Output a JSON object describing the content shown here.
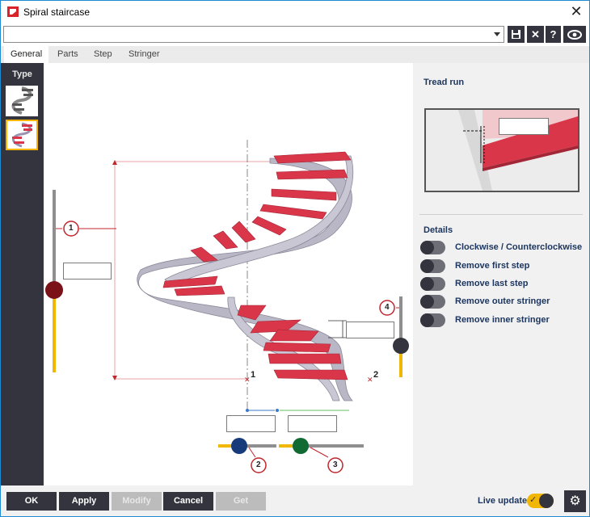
{
  "window": {
    "title": "Spiral staircase"
  },
  "toolbar": {
    "combo_value": "",
    "save_icon": "save-icon",
    "delete_icon": "close-icon",
    "help_label": "?",
    "view_icon": "eye-icon"
  },
  "tabs": [
    {
      "label": "General",
      "active": true
    },
    {
      "label": "Parts",
      "active": false
    },
    {
      "label": "Step",
      "active": false
    },
    {
      "label": "Stringer",
      "active": false
    }
  ],
  "type_panel": {
    "label": "Type"
  },
  "canvas": {
    "marker_1": "1",
    "marker_2": "2",
    "marker_3": "3",
    "marker_4": "4",
    "point_1": "1",
    "point_2": "2",
    "height_value": "",
    "step_height_value": "",
    "width_value_1": "",
    "width_value_2": ""
  },
  "right_panel": {
    "tread_run_title": "Tread run",
    "tread_run_value": "",
    "details_title": "Details",
    "details": [
      {
        "label": "Clockwise / Counterclockwise"
      },
      {
        "label": "Remove first step"
      },
      {
        "label": "Remove last step"
      },
      {
        "label": "Remove outer stringer"
      },
      {
        "label": "Remove inner stringer"
      }
    ]
  },
  "footer": {
    "ok": "OK",
    "apply": "Apply",
    "modify": "Modify",
    "cancel": "Cancel",
    "get": "Get",
    "live_update": "Live update"
  },
  "colors": {
    "accent": "#f2b705",
    "dark": "#34343f",
    "tread": "#d9364a",
    "stringer": "#b9b6c6",
    "marker": "#c0262c"
  }
}
